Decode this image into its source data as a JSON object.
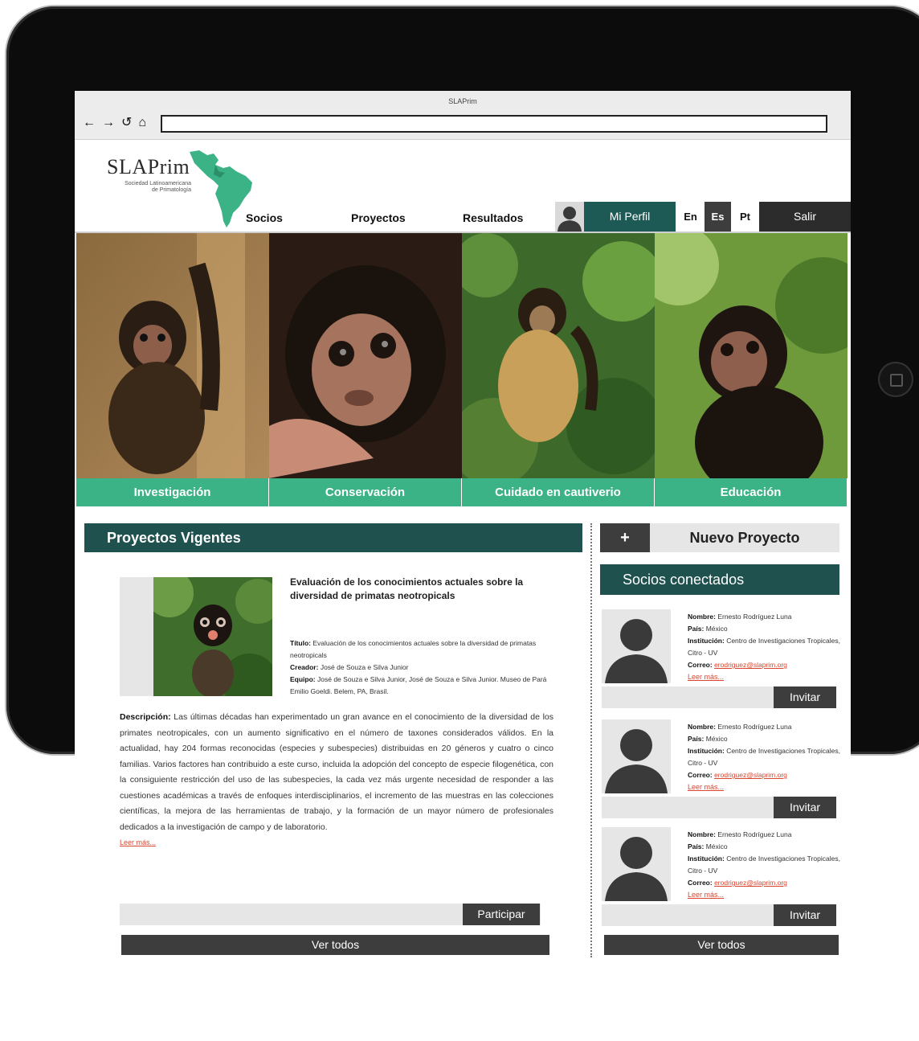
{
  "browser": {
    "title": "SLAPrim",
    "url": ""
  },
  "logo": {
    "name": "SLAPrim",
    "subtitle_1": "Sociedad Latinoamericana",
    "subtitle_2": "de Primatología"
  },
  "menu": {
    "socios": "Socios",
    "proyectos": "Proyectos",
    "resultados": "Resultados"
  },
  "account": {
    "mi_perfil": "Mi Perfil",
    "salir": "Salir",
    "languages": [
      "En",
      "Es",
      "Pt"
    ],
    "active_language": "Es"
  },
  "categories": [
    "Investigación",
    "Conservación",
    "Cuidado en cautiverio",
    "Educación"
  ],
  "projects": {
    "heading": "Proyectos Vigentes",
    "item": {
      "title": "Evaluación de los conocimientos actuales sobre la diversidad de primatas neotropicals",
      "titulo_label": "Título:",
      "titulo_value": "Evaluación de los conocimientos actuales sobre la diversidad de primatas neotropicals",
      "creador_label": "Creador:",
      "creador_value": "José de Souza e Silva Junior",
      "equipo_label": "Equipo:",
      "equipo_value": "José de Souza e Silva Junior, José de Souza e Silva Junior. Museo de Pará Emilio Goeldi. Belem, PA, Brasil.",
      "descripcion_label": "Descripción:",
      "descripcion_value": "Las últimas décadas han experimentado un gran avance en el conocimiento de la diversidad de los primates neotropicales, con un aumento significativo en el número de taxones considerados válidos. En la actualidad, hay 204 formas reconocidas (especies y subespecies) distribuidas en 20 géneros y cuatro o cinco familias. Varios factores han contribuido a este curso, incluida la adopción del concepto de especie filogenética, con la consiguiente restricción del uso de las subespecies, la cada vez más urgente necesidad de responder a las cuestiones académicas a través de enfoques interdisciplinarios, el incremento de las muestras en las colecciones científicas, la mejora de las herramientas de trabajo, y la formación de un mayor número de profesionales dedicados a la investigación de campo y de laboratorio.",
      "read_more": "Leer más..."
    },
    "participar": "Participar",
    "ver_todos": "Ver todos"
  },
  "nuevo_proyecto": {
    "plus": "+",
    "label": "Nuevo Proyecto"
  },
  "socios": {
    "heading": "Socios conectados",
    "members": [
      {
        "nombre_label": "Nombre:",
        "nombre": "Ernesto Rodríguez Luna",
        "pais_label": "País:",
        "pais": "México",
        "institucion_label": "Institución:",
        "institucion": "Centro de Investigaciones Tropicales, Citro - UV",
        "correo_label": "Correo:",
        "correo": "erodriguez@slaprim.org",
        "read_more": "Leer más...",
        "invitar": "Invitar"
      },
      {
        "nombre_label": "Nombre:",
        "nombre": "Ernesto Rodríguez Luna",
        "pais_label": "País:",
        "pais": "México",
        "institucion_label": "Institución:",
        "institucion": "Centro de Investigaciones Tropicales, Citro - UV",
        "correo_label": "Correo:",
        "correo": "erodriguez@slaprim.org",
        "read_more": "Leer más...",
        "invitar": "Invitar"
      },
      {
        "nombre_label": "Nombre:",
        "nombre": "Ernesto Rodríguez Luna",
        "pais_label": "País:",
        "pais": "México",
        "institucion_label": "Institución:",
        "institucion": "Centro de Investigaciones Tropicales, Citro - UV",
        "correo_label": "Correo:",
        "correo": "erodriguez@slaprim.org",
        "read_more": "Leer más...",
        "invitar": "Invitar"
      }
    ],
    "ver_todos": "Ver todos"
  },
  "colors": {
    "brand_dark": "#1f524f",
    "accent_green": "#3cb387",
    "button_dark": "#3d3d3d",
    "link_red": "#d9452e"
  }
}
